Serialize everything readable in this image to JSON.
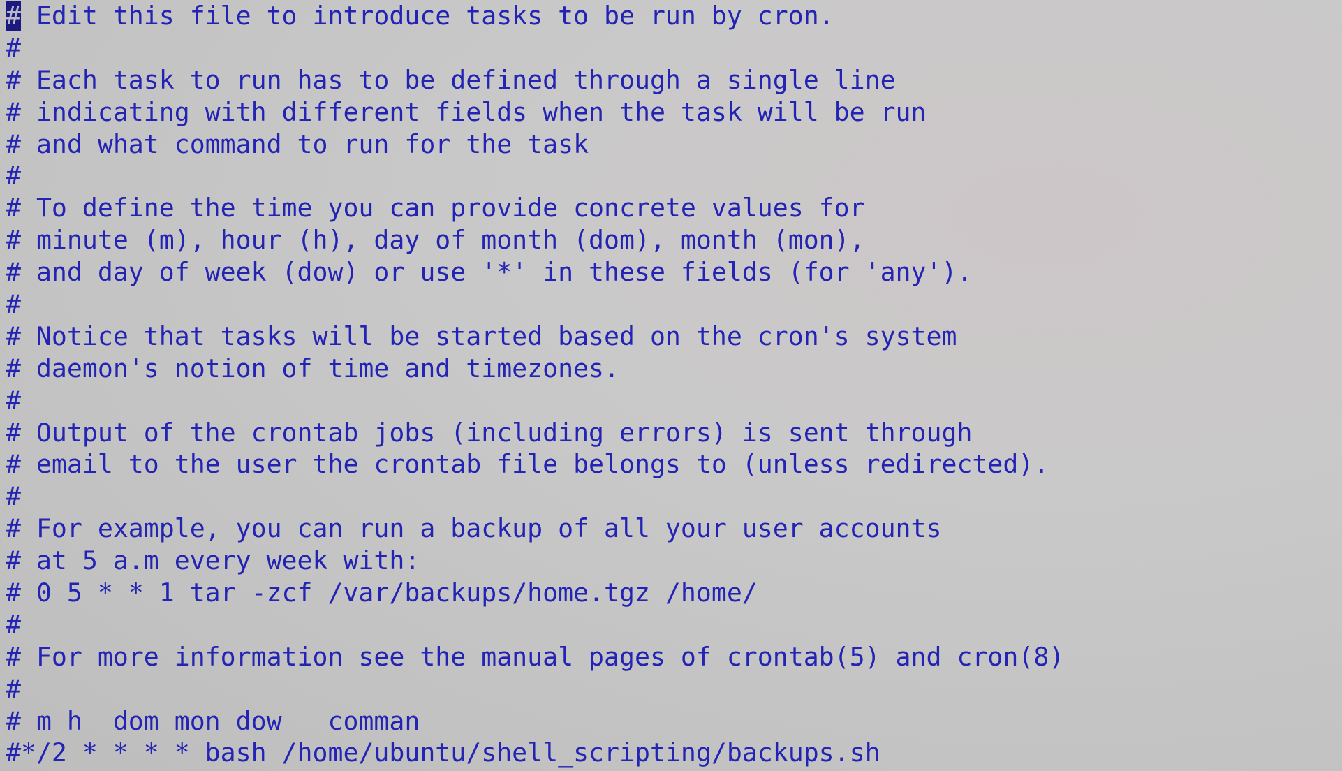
{
  "editor": {
    "cursor_char": "#",
    "first_line_rest": " Edit this file to introduce tasks to be run by cron.",
    "lines": [
      "#",
      "# Each task to run has to be defined through a single line",
      "# indicating with different fields when the task will be run",
      "# and what command to run for the task",
      "#",
      "# To define the time you can provide concrete values for",
      "# minute (m), hour (h), day of month (dom), month (mon),",
      "# and day of week (dow) or use '*' in these fields (for 'any').",
      "#",
      "# Notice that tasks will be started based on the cron's system",
      "# daemon's notion of time and timezones.",
      "#",
      "# Output of the crontab jobs (including errors) is sent through",
      "# email to the user the crontab file belongs to (unless redirected).",
      "#",
      "# For example, you can run a backup of all your user accounts",
      "# at 5 a.m every week with:",
      "# 0 5 * * 1 tar -zcf /var/backups/home.tgz /home/",
      "#",
      "# For more information see the manual pages of crontab(5) and cron(8)",
      "#",
      "# m h  dom mon dow   comman",
      "#*/2 * * * * bash /home/ubuntu/shell_scripting/backups.sh"
    ]
  },
  "colors": {
    "text": "#2323b4",
    "cursor": "#1a1a80"
  }
}
